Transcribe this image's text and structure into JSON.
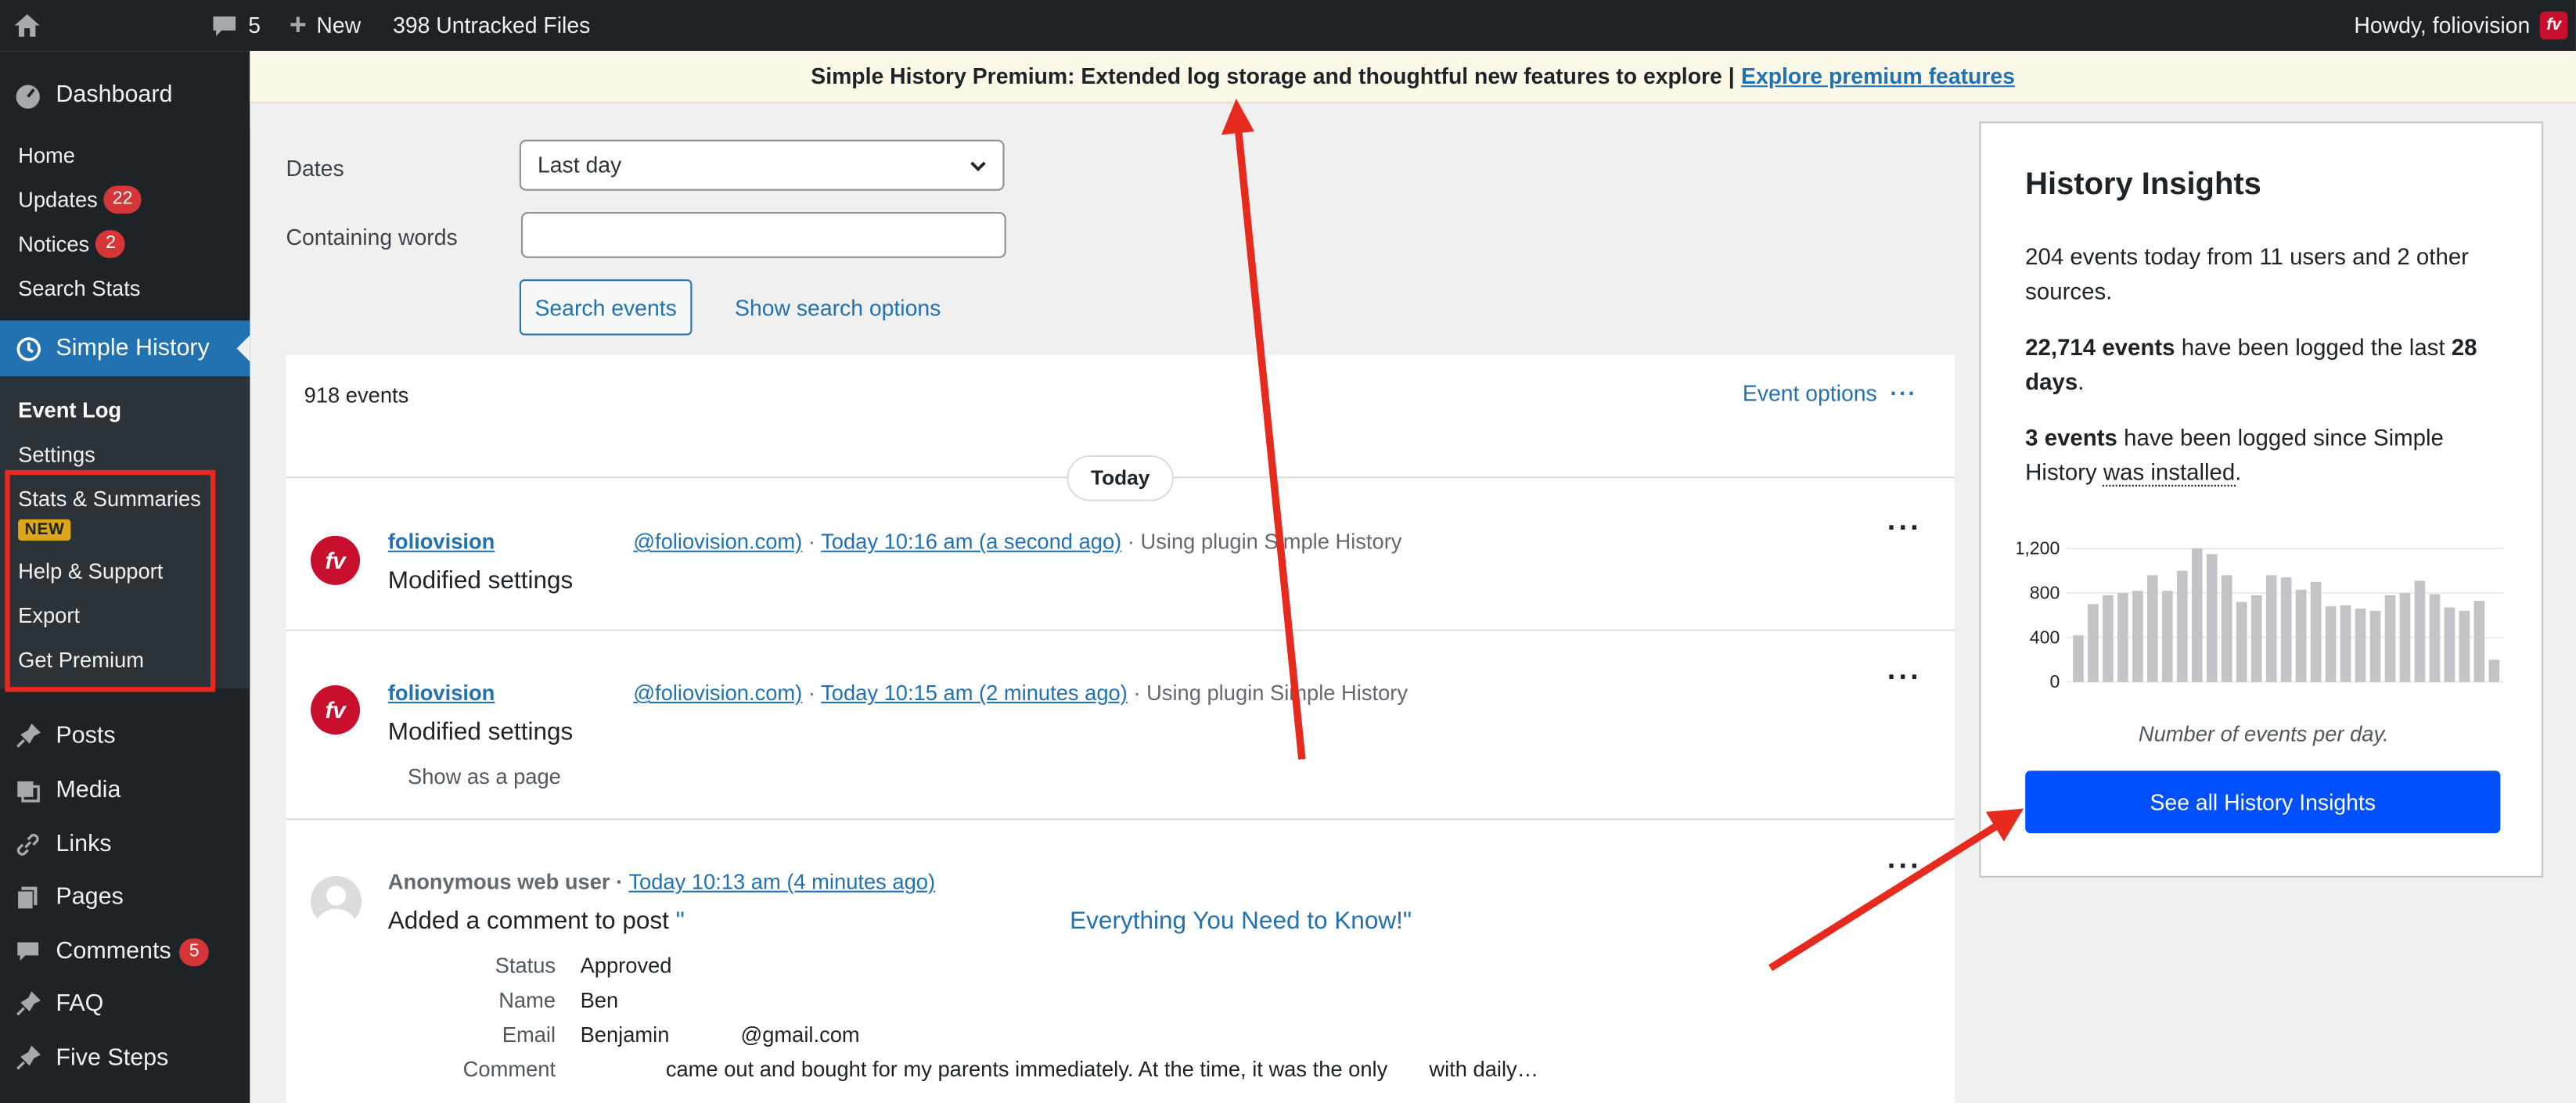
{
  "adminbar": {
    "comments_count": "5",
    "new_label": "New",
    "untracked": "398 Untracked Files",
    "greeting": "Howdy, foliovision",
    "avatar_text": "fv"
  },
  "sidebar": {
    "dashboard": "Dashboard",
    "dashboard_sub": [
      {
        "label": "Home"
      },
      {
        "label": "Updates",
        "badge": "22"
      },
      {
        "label": "Notices",
        "badge": "2"
      },
      {
        "label": "Search Stats"
      }
    ],
    "simple_history": "Simple History",
    "sh_sub": {
      "event_log": "Event Log",
      "settings": "Settings",
      "stats": "Stats & Summaries",
      "new_badge": "NEW",
      "help": "Help & Support",
      "export": "Export",
      "premium": "Get Premium"
    },
    "menu": [
      {
        "label": "Posts",
        "icon": "pin-icon"
      },
      {
        "label": "Media",
        "icon": "media-icon"
      },
      {
        "label": "Links",
        "icon": "link-icon"
      },
      {
        "label": "Pages",
        "icon": "pages-icon"
      },
      {
        "label": "Comments",
        "icon": "comment-icon",
        "badge": "5"
      },
      {
        "label": "FAQ",
        "icon": "pin-icon"
      },
      {
        "label": "Five Steps",
        "icon": "pin-icon"
      }
    ]
  },
  "notice": {
    "text": "Simple History Premium: Extended log storage and thoughtful new features to explore |",
    "link": "Explore premium features"
  },
  "filters": {
    "dates_label": "Dates",
    "dates_value": "Last day",
    "words_label": "Containing words",
    "words_value": "",
    "search_btn": "Search events",
    "options_link": "Show search options"
  },
  "log": {
    "count": "918 events",
    "event_options": "Event options",
    "today": "Today",
    "entries": [
      {
        "user": "foliovision",
        "email": "@foliovision.com)",
        "time": "Today 10:16 am (a second ago)",
        "via": "· Using plugin Simple History",
        "message": "Modified settings"
      },
      {
        "user": "foliovision",
        "email": "@foliovision.com)",
        "time": "Today 10:15 am (2 minutes ago)",
        "via": "· Using plugin Simple History",
        "message": "Modified settings",
        "extra": "Show as a page"
      },
      {
        "user": "Anonymous web user ·",
        "time": "Today 10:13 am (4 minutes ago)",
        "message": "Added a comment to post",
        "post_start": "\"",
        "post_title": "Everything You Need to Know!\"",
        "details": [
          {
            "key": "Status",
            "value": "Approved"
          },
          {
            "key": "Name",
            "value": "Ben"
          },
          {
            "key": "Email",
            "value": "Benjamin            @gmail.com"
          },
          {
            "key": "Comment",
            "value": "came out and bought for my parents immediately. At the time, it was the only       with daily…"
          }
        ]
      }
    ]
  },
  "insights": {
    "title": "History Insights",
    "today_text": "204 events today from 11 users and 2 other sources.",
    "logged_strong": "22,714 events",
    "logged_mid": "have been logged the last",
    "logged_days": "28 days",
    "since_strong": "3 events",
    "since_mid": "have been logged since Simple History",
    "since_link": "was installed",
    "caption": "Number of events per day.",
    "button": "See all History Insights"
  },
  "chart_data": {
    "type": "bar",
    "title": "",
    "xlabel": "",
    "ylabel": "",
    "ylim": [
      0,
      1300
    ],
    "yticks": [
      "0",
      "400",
      "800",
      "1,200"
    ],
    "values": [
      420,
      700,
      780,
      800,
      820,
      960,
      820,
      1000,
      1200,
      1150,
      960,
      720,
      780,
      960,
      940,
      830,
      900,
      680,
      690,
      660,
      640,
      780,
      800,
      910,
      790,
      670,
      640,
      730,
      200
    ],
    "color": "#c3c4c7"
  },
  "colors": {
    "accent": "#2271b1",
    "primary_button": "#0050ff",
    "badge": "#d63638",
    "annotation": "#e62b1e"
  }
}
